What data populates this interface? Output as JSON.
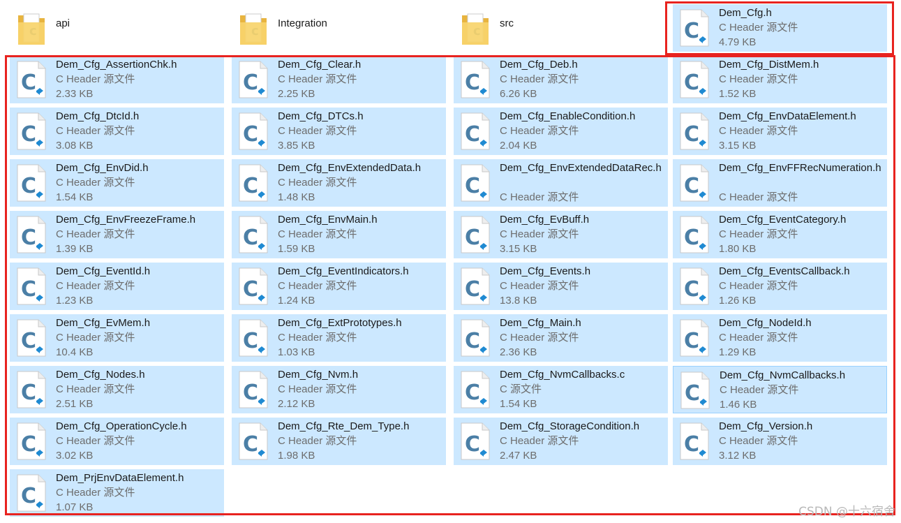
{
  "colors": {
    "selection": "#cce8ff",
    "highlight_box": "#e8231f",
    "c_letter": "#4b7fa6",
    "vscode_badge": "#1f8ad2",
    "folder": "#f3c957"
  },
  "folders": [
    {
      "name": "api",
      "icon": "folder-icon"
    },
    {
      "name": "Integration",
      "icon": "folder-icon"
    },
    {
      "name": "src",
      "icon": "folder-icon"
    }
  ],
  "featured": {
    "name": "Dem_Cfg.h",
    "type": "C Header 源文件",
    "size": "4.79 KB",
    "icon": "c-file-icon"
  },
  "files": [
    {
      "name": "Dem_Cfg_AssertionChk.h",
      "type": "C Header 源文件",
      "size": "2.33 KB"
    },
    {
      "name": "Dem_Cfg_Clear.h",
      "type": "C Header 源文件",
      "size": "2.25 KB"
    },
    {
      "name": "Dem_Cfg_Deb.h",
      "type": "C Header 源文件",
      "size": "6.26 KB"
    },
    {
      "name": "Dem_Cfg_DistMem.h",
      "type": "C Header 源文件",
      "size": "1.52 KB"
    },
    {
      "name": "Dem_Cfg_DtcId.h",
      "type": "C Header 源文件",
      "size": "3.08 KB"
    },
    {
      "name": "Dem_Cfg_DTCs.h",
      "type": "C Header 源文件",
      "size": "3.85 KB"
    },
    {
      "name": "Dem_Cfg_EnableCondition.h",
      "type": "C Header 源文件",
      "size": "2.04 KB"
    },
    {
      "name": "Dem_Cfg_EnvDataElement.h",
      "type": "C Header 源文件",
      "size": "3.15 KB"
    },
    {
      "name": "Dem_Cfg_EnvDid.h",
      "type": "C Header 源文件",
      "size": "1.54 KB"
    },
    {
      "name": "Dem_Cfg_EnvExtendedData.h",
      "type": "C Header 源文件",
      "size": "1.48 KB"
    },
    {
      "name": "Dem_Cfg_EnvExtendedDataRec.h",
      "type": "C Header 源文件",
      "size": ""
    },
    {
      "name": "Dem_Cfg_EnvFFRecNumeration.h",
      "type": "C Header 源文件",
      "size": ""
    },
    {
      "name": "Dem_Cfg_EnvFreezeFrame.h",
      "type": "C Header 源文件",
      "size": "1.39 KB"
    },
    {
      "name": "Dem_Cfg_EnvMain.h",
      "type": "C Header 源文件",
      "size": "1.59 KB"
    },
    {
      "name": "Dem_Cfg_EvBuff.h",
      "type": "C Header 源文件",
      "size": "3.15 KB"
    },
    {
      "name": "Dem_Cfg_EventCategory.h",
      "type": "C Header 源文件",
      "size": "1.80 KB"
    },
    {
      "name": "Dem_Cfg_EventId.h",
      "type": "C Header 源文件",
      "size": "1.23 KB"
    },
    {
      "name": "Dem_Cfg_EventIndicators.h",
      "type": "C Header 源文件",
      "size": "1.24 KB"
    },
    {
      "name": "Dem_Cfg_Events.h",
      "type": "C Header 源文件",
      "size": "13.8 KB"
    },
    {
      "name": "Dem_Cfg_EventsCallback.h",
      "type": "C Header 源文件",
      "size": "1.26 KB"
    },
    {
      "name": "Dem_Cfg_EvMem.h",
      "type": "C Header 源文件",
      "size": "10.4 KB"
    },
    {
      "name": "Dem_Cfg_ExtPrototypes.h",
      "type": "C Header 源文件",
      "size": "1.03 KB"
    },
    {
      "name": "Dem_Cfg_Main.h",
      "type": "C Header 源文件",
      "size": "2.36 KB"
    },
    {
      "name": "Dem_Cfg_NodeId.h",
      "type": "C Header 源文件",
      "size": "1.29 KB"
    },
    {
      "name": "Dem_Cfg_Nodes.h",
      "type": "C Header 源文件",
      "size": "2.51 KB"
    },
    {
      "name": "Dem_Cfg_Nvm.h",
      "type": "C Header 源文件",
      "size": "2.12 KB"
    },
    {
      "name": "Dem_Cfg_NvmCallbacks.c",
      "type": "C 源文件",
      "size": "1.54 KB"
    },
    {
      "name": "Dem_Cfg_NvmCallbacks.h",
      "type": "C Header 源文件",
      "size": "1.46 KB"
    },
    {
      "name": "Dem_Cfg_OperationCycle.h",
      "type": "C Header 源文件",
      "size": "3.02 KB"
    },
    {
      "name": "Dem_Cfg_Rte_Dem_Type.h",
      "type": "C Header 源文件",
      "size": "1.98 KB"
    },
    {
      "name": "Dem_Cfg_StorageCondition.h",
      "type": "C Header 源文件",
      "size": "2.47 KB"
    },
    {
      "name": "Dem_Cfg_Version.h",
      "type": "C Header 源文件",
      "size": "3.12 KB"
    },
    {
      "name": "Dem_PrjEnvDataElement.h",
      "type": "C Header 源文件",
      "size": "1.07 KB"
    }
  ],
  "watermark": "CSDN @十六宿舍"
}
